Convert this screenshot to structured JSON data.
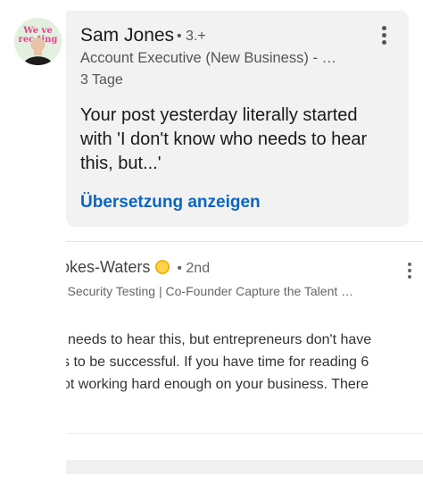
{
  "comment": {
    "author_name": "Sam Jones",
    "degree": "• 3.+",
    "headline": "Account Executive (New Business) - …",
    "time": "3 Tage",
    "text": "Your post yesterday literally started with 'I don't know who needs to hear this, but...'",
    "translate_label": "Übersetzung anzeigen",
    "avatar_text_top": "We  ve",
    "avatar_text_bottom": "rec ting",
    "more_icon": "three-dots-vertical-icon"
  },
  "post": {
    "author_name_partial": "okes-Waters",
    "degree": "• 2nd",
    "headline_partial": "| Security Testing | Co-Founder Capture the Talent …",
    "text_lines": [
      "needs to hear this, but entrepreneurs don't have",
      "s to be successful. If you have time for reading 6",
      "ot working hard enough on your business. There"
    ],
    "badge_icon": "sun-badge-icon"
  },
  "colors": {
    "link": "#0a66c2",
    "bubble_bg": "#f2f2f2",
    "text_primary": "#1a1a1a",
    "text_secondary": "#555555"
  }
}
